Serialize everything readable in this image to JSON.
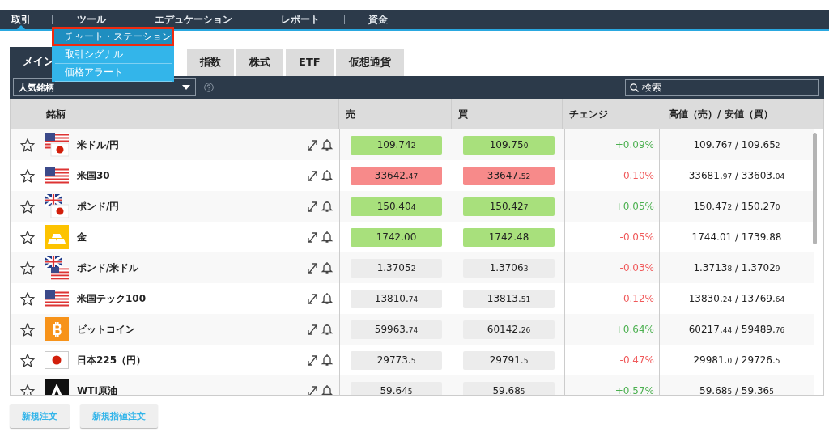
{
  "nav": [
    {
      "label": "取引",
      "selected": true
    },
    {
      "label": "ツール",
      "selected": false
    },
    {
      "label": "エデュケーション",
      "selected": false
    },
    {
      "label": "レポート",
      "selected": false
    },
    {
      "label": "資金",
      "selected": false
    }
  ],
  "dropdown_menu": [
    {
      "label": "チャート・ステーション",
      "selected": true
    },
    {
      "label": "取引シグナル",
      "selected": false
    },
    {
      "label": "価格アラート",
      "selected": false
    }
  ],
  "tabs": [
    {
      "label": "メイン",
      "selected": true
    },
    {
      "label": "指数",
      "selected": false
    },
    {
      "label": "株式",
      "selected": false
    },
    {
      "label": "ETF",
      "selected": false
    },
    {
      "label": "仮想通貨",
      "selected": false
    }
  ],
  "filter_select": {
    "value": "人気銘柄"
  },
  "search": {
    "placeholder": "検索"
  },
  "columns": [
    "銘柄",
    "売",
    "買",
    "チェンジ",
    "高値（売）/ 安値（買）"
  ],
  "rows": [
    {
      "kind": "usjp",
      "name": "米ドル/円",
      "favorite": false,
      "sell": {
        "main": "109.74",
        "pip": "2",
        "color": "#a8e07c"
      },
      "buy": {
        "main": "109.75",
        "pip": "0",
        "color": "#a8e07c"
      },
      "change": {
        "text": "+0.09%",
        "color": "#4cb050"
      },
      "high_low": [
        {
          "main": "109.76",
          "pip": "7"
        },
        {
          "main": " / "
        },
        {
          "main": "109.65",
          "pip": "2"
        }
      ]
    },
    {
      "kind": "us",
      "name": "米国30",
      "favorite": false,
      "sell": {
        "main": "33642.",
        "pip": "47",
        "color": "#f78a8a"
      },
      "buy": {
        "main": "33647.",
        "pip": "52",
        "color": "#f78a8a"
      },
      "change": {
        "text": "-0.10%",
        "color": "#f0595a"
      },
      "high_low": [
        {
          "main": "33681.",
          "pip": "97"
        },
        {
          "main": " / "
        },
        {
          "main": "33603.",
          "pip": "04"
        }
      ]
    },
    {
      "kind": "gbjp",
      "name": "ポンド/円",
      "favorite": false,
      "sell": {
        "main": "150.40",
        "pip": "4",
        "color": "#a8e07c"
      },
      "buy": {
        "main": "150.42",
        "pip": "7",
        "color": "#a8e07c"
      },
      "change": {
        "text": "+0.05%",
        "color": "#4cb050"
      },
      "high_low": [
        {
          "main": "150.47",
          "pip": "2"
        },
        {
          "main": " / "
        },
        {
          "main": "150.27",
          "pip": "0"
        }
      ]
    },
    {
      "kind": "gold",
      "name": "金",
      "favorite": false,
      "sell": {
        "main": "1742.00",
        "color": "#a8e07c"
      },
      "buy": {
        "main": "1742.48",
        "color": "#a8e07c"
      },
      "change": {
        "text": "-0.05%",
        "color": "#f0595a"
      },
      "high_low": [
        {
          "main": "1744.01"
        },
        {
          "main": " / "
        },
        {
          "main": "1739.88"
        }
      ]
    },
    {
      "kind": "gbus",
      "name": "ポンド/米ドル",
      "favorite": false,
      "sell": {
        "main": "1.3705",
        "pip": "2",
        "color": "#ececec"
      },
      "buy": {
        "main": "1.3706",
        "pip": "3",
        "color": "#ececec"
      },
      "change": {
        "text": "-0.03%",
        "color": "#f0595a"
      },
      "high_low": [
        {
          "main": "1.3713",
          "pip": "8"
        },
        {
          "main": " / "
        },
        {
          "main": "1.3702",
          "pip": "9"
        }
      ]
    },
    {
      "kind": "us",
      "name": "米国テック100",
      "favorite": false,
      "sell": {
        "main": "13810.",
        "pip": "74",
        "color": "#ececec"
      },
      "buy": {
        "main": "13813.",
        "pip": "51",
        "color": "#ececec"
      },
      "change": {
        "text": "-0.12%",
        "color": "#f0595a"
      },
      "high_low": [
        {
          "main": "13830.",
          "pip": "24"
        },
        {
          "main": " / "
        },
        {
          "main": "13769.",
          "pip": "64"
        }
      ]
    },
    {
      "kind": "bitcoin",
      "name": "ビットコイン",
      "favorite": false,
      "sell": {
        "main": "59963.",
        "pip": "74",
        "color": "#ececec"
      },
      "buy": {
        "main": "60142.",
        "pip": "26",
        "color": "#ececec"
      },
      "change": {
        "text": "+0.64%",
        "color": "#4cb050"
      },
      "high_low": [
        {
          "main": "60217.",
          "pip": "44"
        },
        {
          "main": " / "
        },
        {
          "main": "59489.",
          "pip": "76"
        }
      ]
    },
    {
      "kind": "jp",
      "name": "日本225（円）",
      "favorite": false,
      "sell": {
        "main": "29773.",
        "pip": "5",
        "color": "#ececec"
      },
      "buy": {
        "main": "29791.",
        "pip": "5",
        "color": "#ececec"
      },
      "change": {
        "text": "-0.47%",
        "color": "#f0595a"
      },
      "high_low": [
        {
          "main": "29981.",
          "pip": "0"
        },
        {
          "main": " / "
        },
        {
          "main": "29726.",
          "pip": "5"
        }
      ]
    },
    {
      "kind": "oil",
      "name": "WTI原油",
      "favorite": false,
      "sell": {
        "main": "59.64",
        "pip": "5",
        "color": "#ececec"
      },
      "buy": {
        "main": "59.68",
        "pip": "5",
        "color": "#ececec"
      },
      "change": {
        "text": "+0.57%",
        "color": "#4cb050"
      },
      "high_low": [
        {
          "main": "59.68",
          "pip": "5"
        },
        {
          "main": " / "
        },
        {
          "main": "59.36",
          "pip": "5"
        }
      ]
    }
  ],
  "buttons": [
    "新規注文",
    "新規指値注文"
  ]
}
